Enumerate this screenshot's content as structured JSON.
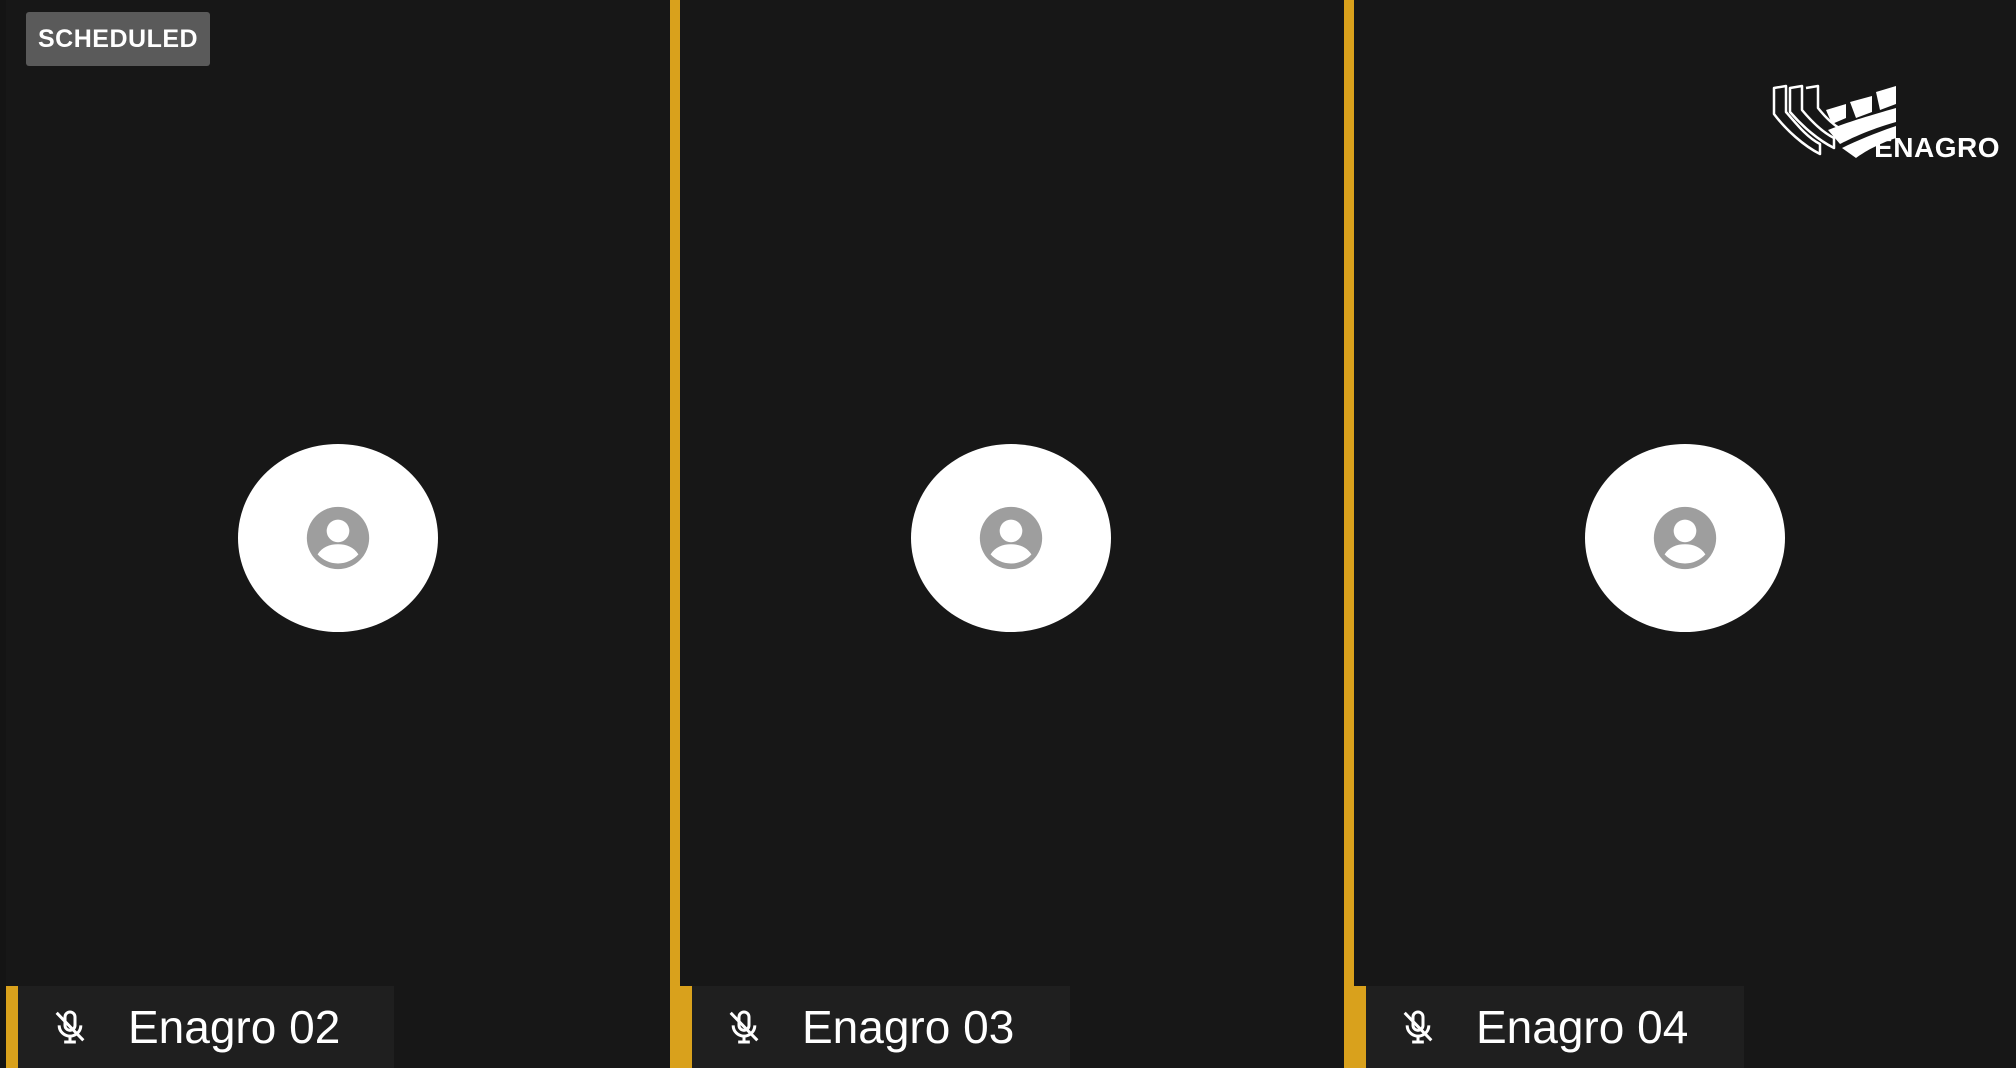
{
  "status_badge": "SCHEDULED",
  "logo": {
    "text": "ENAGRO"
  },
  "participants": [
    {
      "name": "Enagro 02",
      "muted": true
    },
    {
      "name": "Enagro 03",
      "muted": true
    },
    {
      "name": "Enagro 04",
      "muted": true
    }
  ],
  "colors": {
    "background": "#171717",
    "accent": "#d9a11c",
    "avatar_bg": "#ffffff",
    "avatar_icon": "#9e9e9e",
    "badge_bg": "#5a5a5a"
  },
  "icons": {
    "avatar": "person-placeholder-icon",
    "mic": "mic-off-icon",
    "logo": "enagro-logo-icon"
  }
}
